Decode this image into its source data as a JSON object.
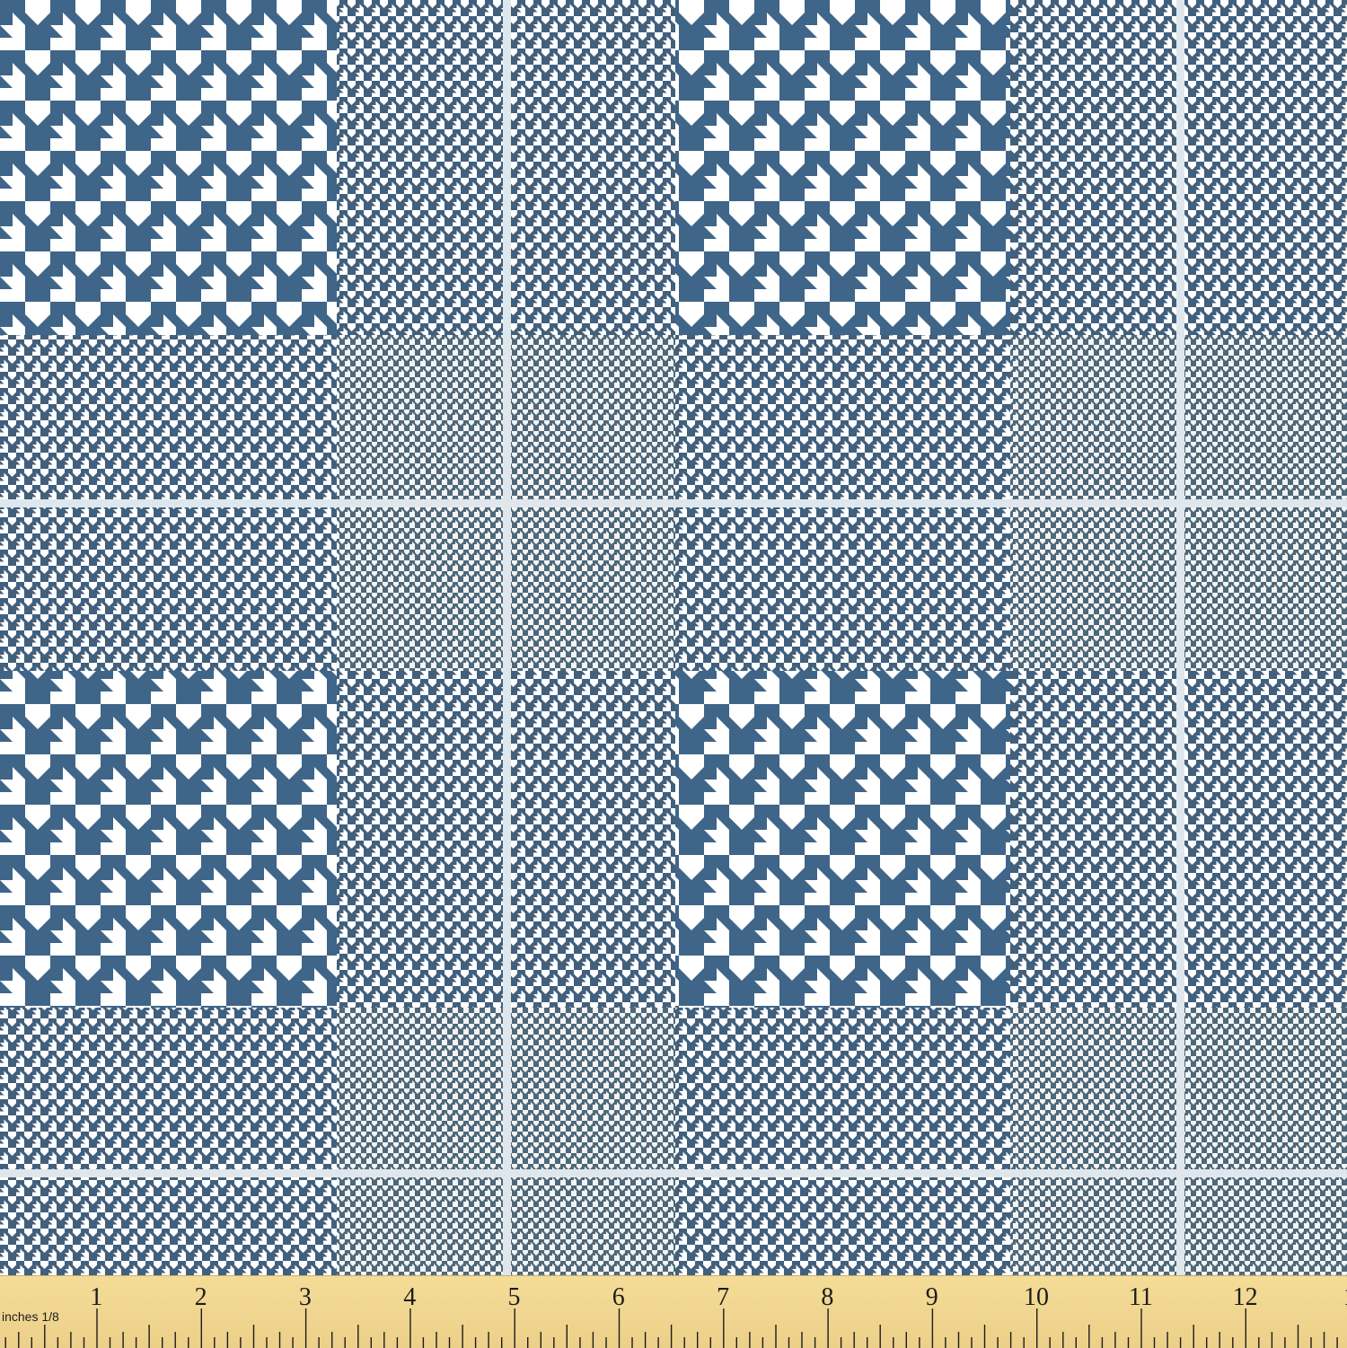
{
  "colors": {
    "navy": "#3f6589",
    "slate": "#4a6478",
    "white": "#ffffff",
    "windowpane": "#dfe7ec",
    "ruler": "#f1d891",
    "ruler_text": "#1d1d1d"
  },
  "ruler": {
    "unit_label": "inches 1/8",
    "numbers": [
      "1",
      "2",
      "3",
      "4",
      "5",
      "6",
      "7",
      "8",
      "9",
      "10",
      "11",
      "12",
      "1"
    ]
  }
}
